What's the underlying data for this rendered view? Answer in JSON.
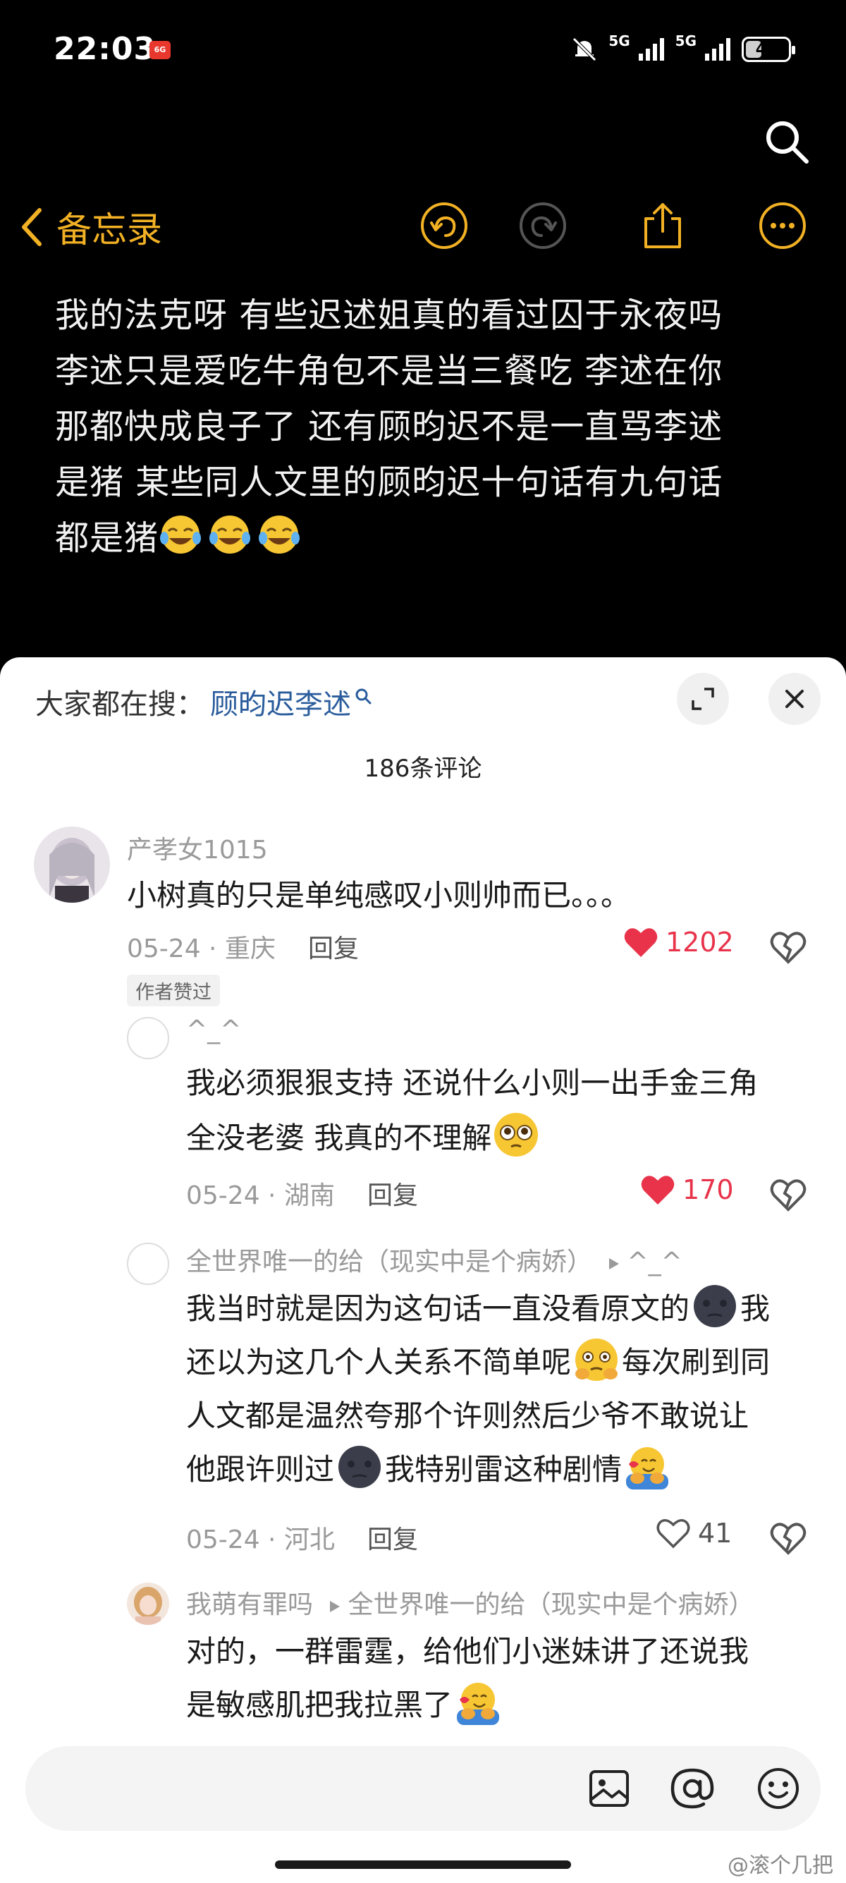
{
  "status": {
    "time": "22:03",
    "badge": "6G",
    "net1": "5G",
    "net2": "5G",
    "battery": "43",
    "battery_level": 0.43
  },
  "nav": {
    "back_label": "备忘录"
  },
  "note": {
    "lines": [
      "我的法克呀 有些迟述姐真的看过囚于永夜吗",
      "李述只是爱吃牛角包不是当三餐吃 李述在你",
      "那都快成良子了 还有顾昀迟不是一直骂李述",
      "是猪 某些同人文里的顾昀迟十句话有九句话",
      "都是猪"
    ]
  },
  "sheet": {
    "trending_prefix": "大家都在搜：",
    "trending_term": "顾昀迟李述",
    "comment_count": "186条评论"
  },
  "comments": [
    {
      "user": "产孝女1015",
      "text": "小树真的只是单纯感叹小则帅而已。。。",
      "date": "05-24",
      "location": "重庆",
      "reply": "回复",
      "likes": "1202",
      "badge": "作者赞过"
    },
    {
      "user": "^_^",
      "text_lines": [
        "我必须狠狠支持 还说什么小则一出手金三角",
        "全没老婆 我真的不理解"
      ],
      "date": "05-24",
      "location": "湖南",
      "reply": "回复",
      "likes": "170"
    },
    {
      "user": "全世界唯一的给（现实中是个病娇）",
      "reply_to": "^_^",
      "text_lines": [
        "我当时就是因为这句话一直没看原文的",
        "还以为这几个人关系不简单呢",
        "每次刷到同",
        "人文都是温然夸那个许则然后少爷不敢说让",
        "他跟许则过",
        "我特别雷这种剧情"
      ],
      "date": "05-24",
      "location": "河北",
      "reply": "回复",
      "likes": "41"
    },
    {
      "user": "我萌有罪吗",
      "reply_to": "全世界唯一的给（现实中是个病娇）",
      "text_lines": [
        "对的，一群雷霆，给他们小迷妹讲了还说我",
        "是敏感肌把我拉黑了"
      ]
    }
  ],
  "watermark": "@滚个几把",
  "colors": {
    "accent": "#f2b124",
    "like_red": "#e8334a",
    "link_blue": "#2a5c9c"
  }
}
